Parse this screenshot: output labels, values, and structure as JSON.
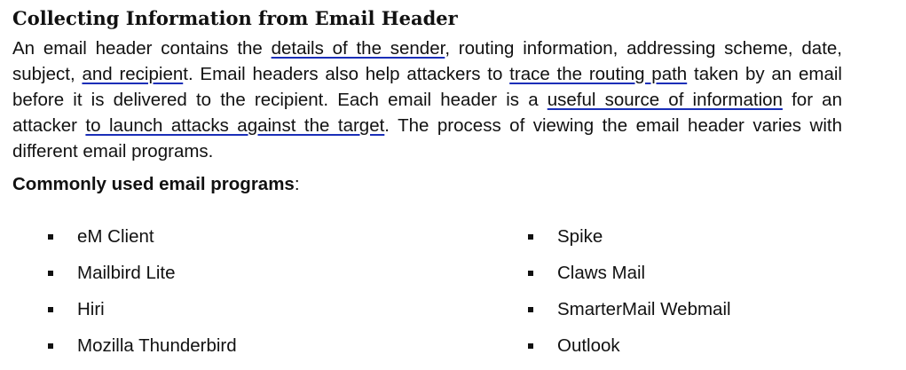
{
  "heading": "Collecting Information from Email Header",
  "paragraph": {
    "s1": "An email header contains the ",
    "u1": "details of the sender",
    "s2": ", routing information, addressing scheme, date, subject, ",
    "u2": "and recipien",
    "s3": "t. Email headers also help attackers to ",
    "u3": "trace the routing path",
    "s4": " taken by an email before it is delivered to the recipient. Each email header is a ",
    "u4": "useful source of information",
    "s5": " for an attacker ",
    "u5": "to launch attacks against the target",
    "s6": ". The process of viewing the email header varies with different email programs."
  },
  "programs_heading": {
    "bold": "Commonly used email programs",
    "suffix": ":"
  },
  "programs_left": [
    "eM Client",
    "Mailbird Lite",
    "Hiri",
    "Mozilla Thunderbird"
  ],
  "programs_right": [
    "Spike",
    "Claws Mail",
    "SmarterMail Webmail",
    "Outlook"
  ],
  "colors": {
    "text": "#111111",
    "underline": "#1a2fb8"
  }
}
